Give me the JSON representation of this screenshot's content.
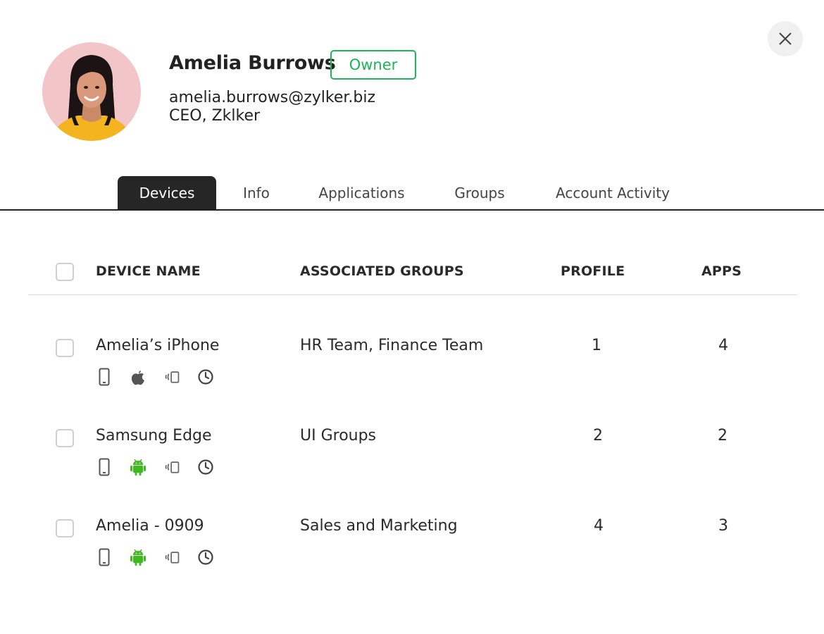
{
  "user": {
    "name": "Amelia Burrows",
    "role": "Owner",
    "email": "amelia.burrows@zylker.biz",
    "title": "CEO, Zklker"
  },
  "tabs": [
    {
      "label": "Devices",
      "active": true
    },
    {
      "label": "Info",
      "active": false
    },
    {
      "label": "Applications",
      "active": false
    },
    {
      "label": "Groups",
      "active": false
    },
    {
      "label": "Account Activity",
      "active": false
    }
  ],
  "table": {
    "headers": {
      "device": "DEVICE NAME",
      "groups": "ASSOCIATED GROUPS",
      "profile": "PROFILE",
      "apps": "APPS"
    },
    "rows": [
      {
        "device": "Amelia’s iPhone",
        "groups": "HR Team, Finance Team",
        "profile": "1",
        "apps": "4",
        "os_icon": "apple-icon"
      },
      {
        "device": "Samsung Edge",
        "groups": "UI Groups",
        "profile": "2",
        "apps": "2",
        "os_icon": "android-icon"
      },
      {
        "device": "Amelia - 0909",
        "groups": "Sales and Marketing",
        "profile": "4",
        "apps": "3",
        "os_icon": "android-icon"
      }
    ]
  },
  "colors": {
    "accent_green": "#1eb45a",
    "android_green": "#3dbb1c",
    "tab_active_bg": "#262626"
  }
}
